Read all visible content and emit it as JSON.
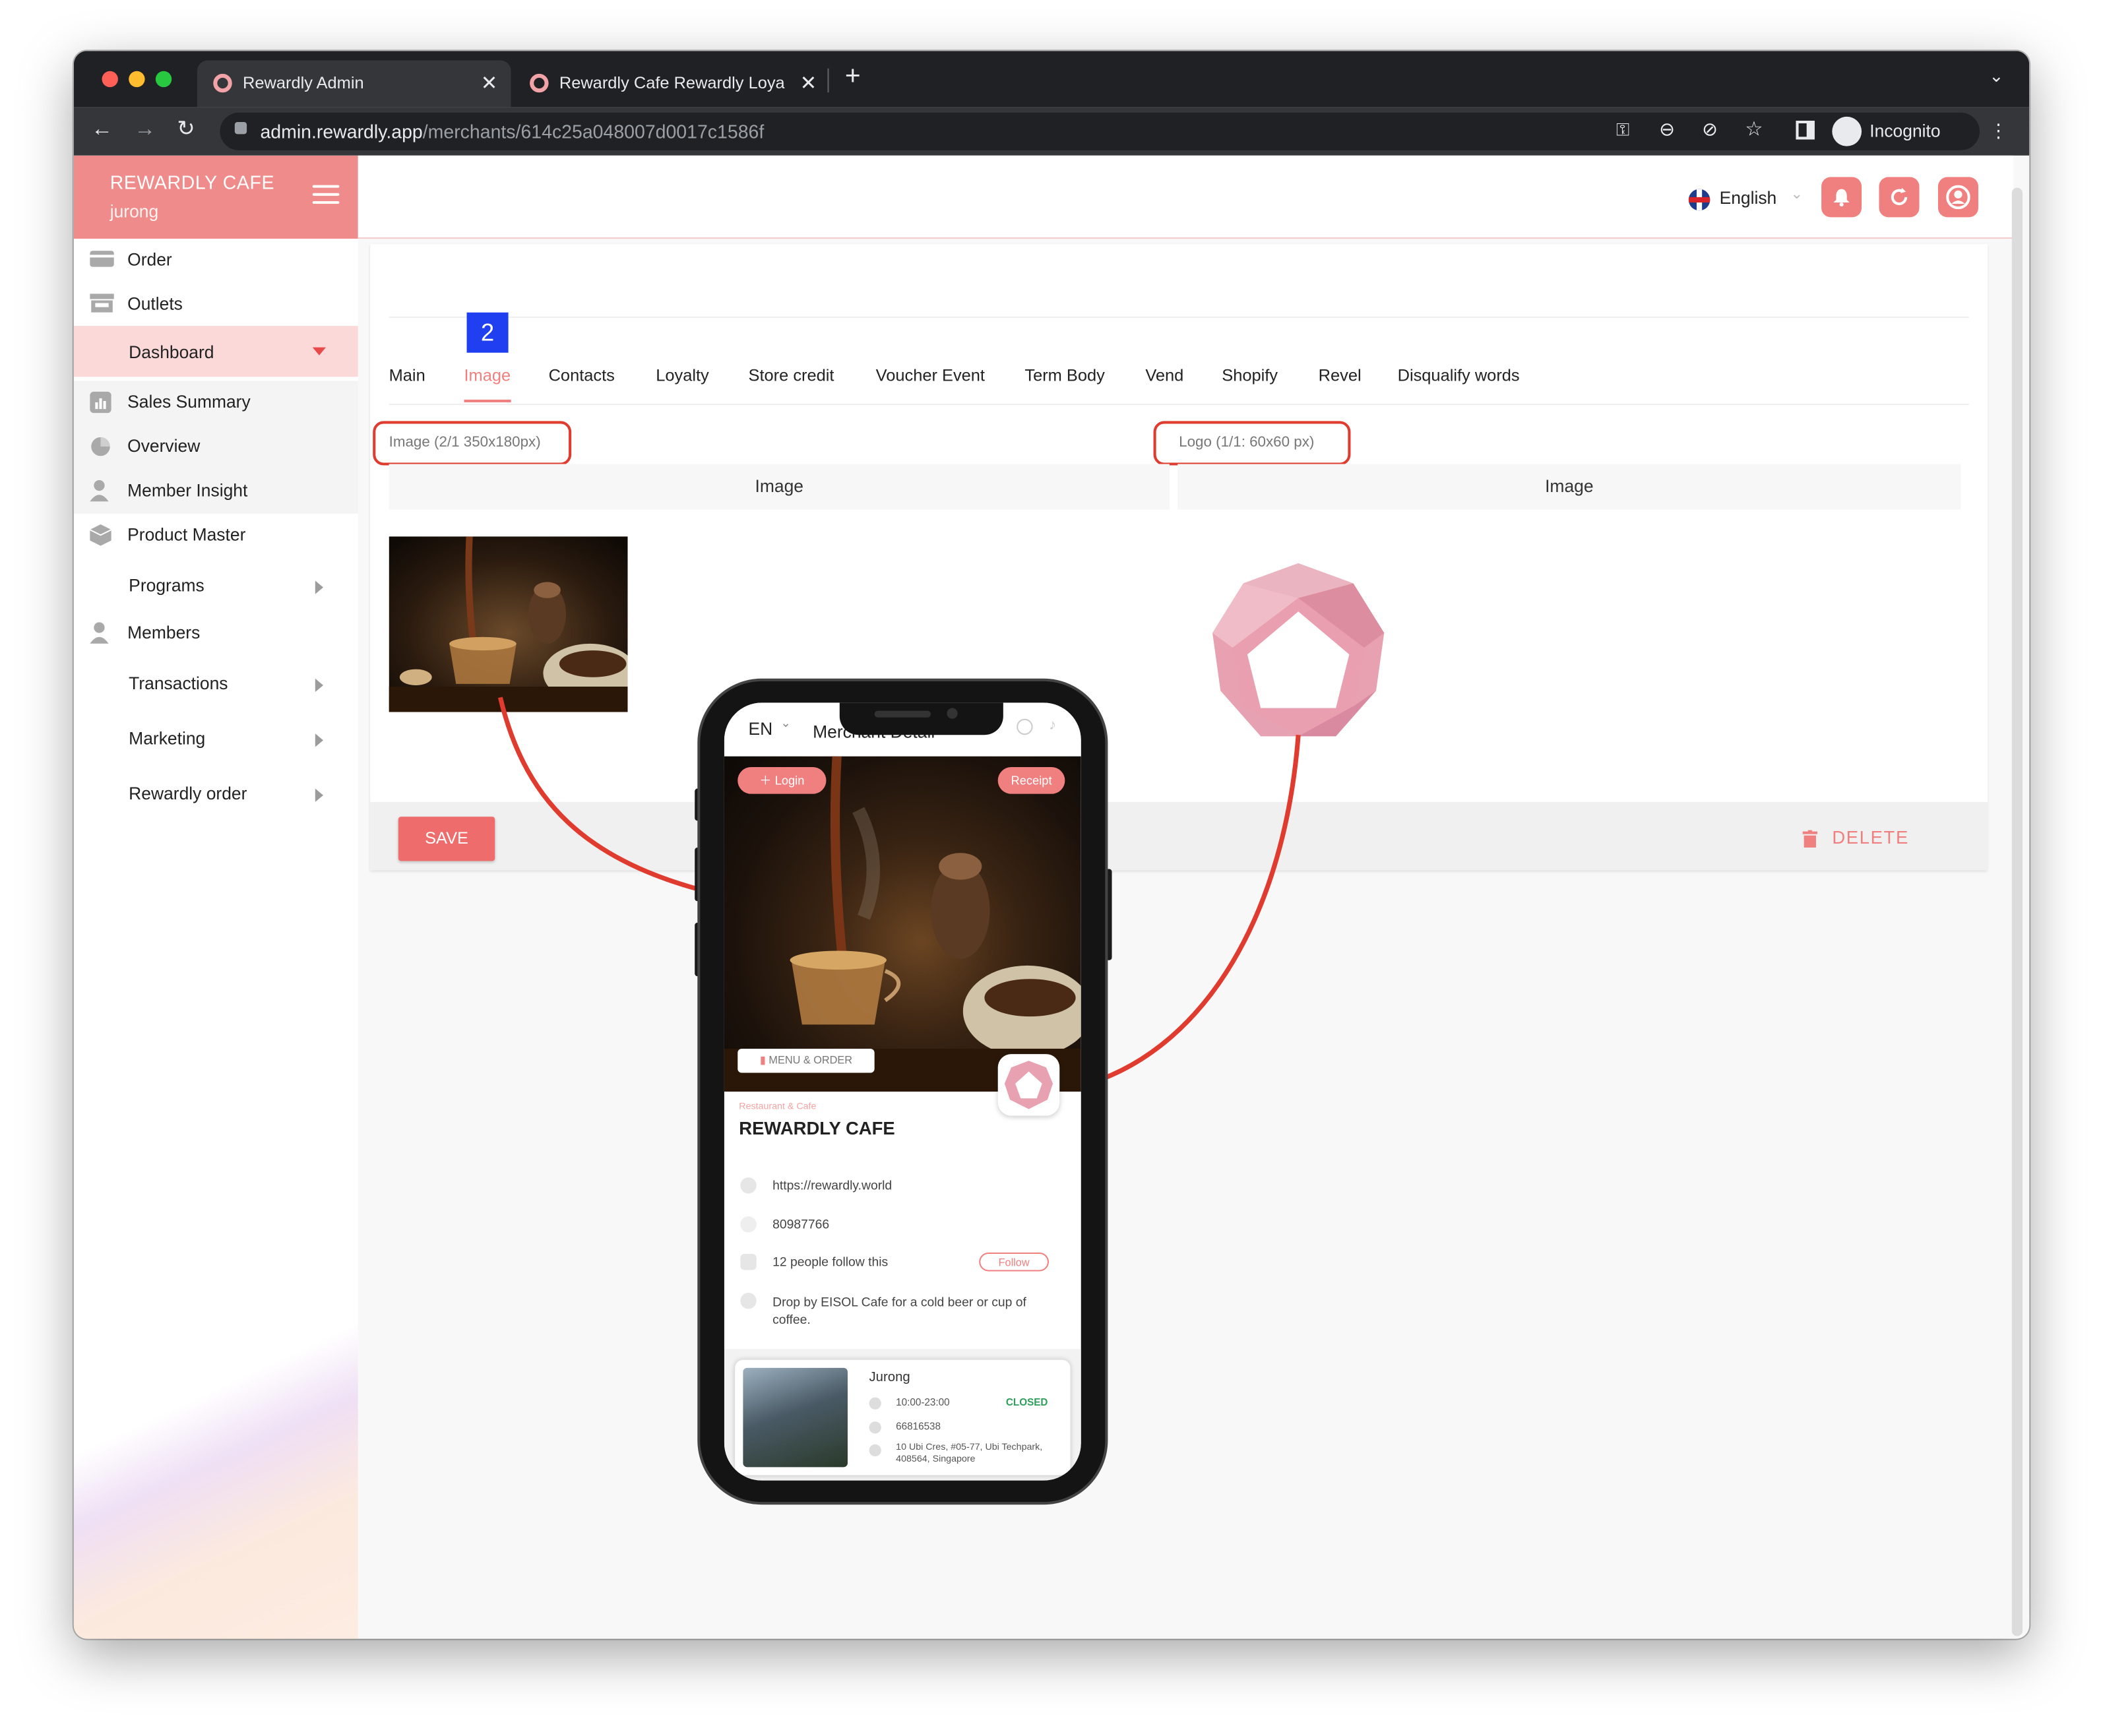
{
  "browser": {
    "tabs": [
      {
        "title": "Rewardly Admin",
        "active": true
      },
      {
        "title": "Rewardly Cafe Rewardly Loyalt",
        "active": false
      }
    ],
    "url_domain": "admin.rewardly.app",
    "url_path": "/merchants/614c25a048007d0017c1586f",
    "profile_label": "Incognito"
  },
  "sidebar": {
    "brand_name": "REWARDLY CAFE",
    "brand_sub": "jurong",
    "items": [
      {
        "label": "Order",
        "icon": "card-icon"
      },
      {
        "label": "Outlets",
        "icon": "store-icon"
      },
      {
        "label": "Dashboard",
        "icon": "",
        "active": true
      },
      {
        "label": "Sales Summary",
        "icon": "bar-chart-icon"
      },
      {
        "label": "Overview",
        "icon": "pie-chart-icon"
      },
      {
        "label": "Member Insight",
        "icon": "user-icon"
      },
      {
        "label": "Product Master",
        "icon": "box-icon"
      },
      {
        "label": "Programs",
        "icon": ""
      },
      {
        "label": "Members",
        "icon": "user-icon"
      },
      {
        "label": "Transactions",
        "icon": ""
      },
      {
        "label": "Marketing",
        "icon": ""
      },
      {
        "label": "Rewardly order",
        "icon": ""
      }
    ]
  },
  "header": {
    "language": "English"
  },
  "merchant": {
    "step_badge": "2",
    "tabs": [
      "Main",
      "Image",
      "Contacts",
      "Loyalty",
      "Store credit",
      "Voucher Event",
      "Term Body",
      "Vend",
      "Shopify",
      "Revel",
      "Disqualify words"
    ],
    "active_tab": "Image",
    "image_field_label": "Image (2/1 350x180px)",
    "logo_field_label": "Logo (1/1: 60x60 px)",
    "column_header_left": "Image",
    "column_header_right": "Image",
    "save_label": "SAVE",
    "delete_label": "DELETE"
  },
  "phone": {
    "language": "EN",
    "header_title": "Merchant Detail",
    "login_label": "Login",
    "receipt_label": "Receipt",
    "menu_order_label": "MENU & ORDER",
    "category": "Restaurant & Cafe",
    "name": "REWARDLY CAFE",
    "website": "https://rewardly.world",
    "phone": "80987766",
    "followers": "12 people follow this",
    "follow_label": "Follow",
    "description": "Drop by EISOL Cafe for a cold beer or cup of coffee.",
    "outlet": {
      "name": "Jurong",
      "hours": "10:00-23:00",
      "status": "CLOSED",
      "phone": "66816538",
      "address": "10 Ubi Cres, #05-77, Ubi Techpark, 408564, Singapore"
    }
  },
  "colors": {
    "brand": "#f08b8b",
    "accent": "#f08080",
    "annotation": "#e03b2f",
    "badge": "#1f3ff0",
    "closed": "#2e9e5b"
  }
}
